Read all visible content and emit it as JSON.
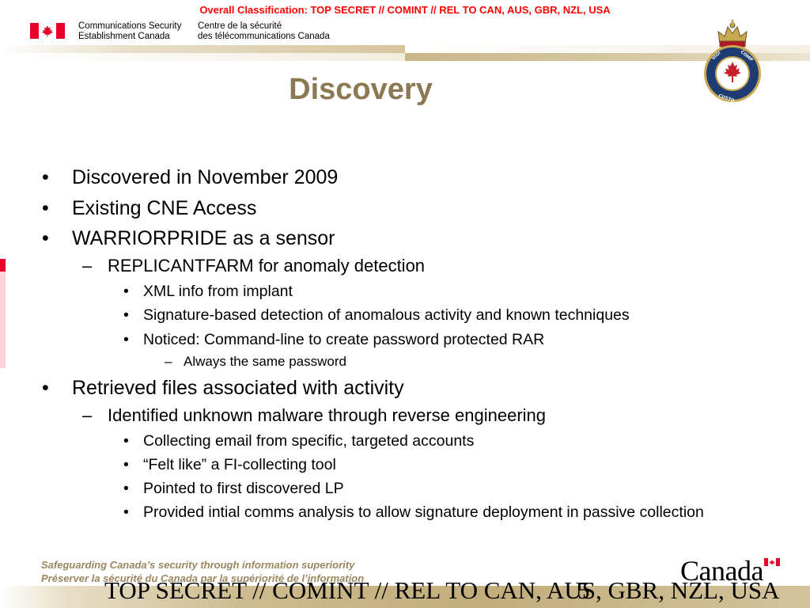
{
  "header": {
    "classification": "Overall Classification: TOP SECRET // COMINT // REL TO CAN, AUS, GBR, NZL, USA",
    "org_en_line1": "Communications Security",
    "org_en_line2": "Establishment Canada",
    "org_fr_line1": "Centre de la sécurité",
    "org_fr_line2": "des télécommunications Canada",
    "crest_motto": "VIGILANTIA NOSTRUM COMPANIE",
    "flag_icon": "canada-flag-icon"
  },
  "title": "Discovery",
  "bullets": [
    {
      "level": 1,
      "marker": "•",
      "text": "Discovered in November 2009"
    },
    {
      "level": 1,
      "marker": "•",
      "text": "Existing CNE Access"
    },
    {
      "level": 1,
      "marker": "•",
      "text": "WARRIORPRIDE as a sensor"
    },
    {
      "level": 2,
      "marker": "–",
      "text": "REPLICANTFARM for anomaly detection"
    },
    {
      "level": 3,
      "marker": "•",
      "text": "XML info from implant"
    },
    {
      "level": 3,
      "marker": "•",
      "text": "Signature-based detection of anomalous activity and known techniques"
    },
    {
      "level": 3,
      "marker": "•",
      "text": "Noticed: Command-line to create password protected RAR"
    },
    {
      "level": 4,
      "marker": "–",
      "text": "Always the same password"
    },
    {
      "level": 1,
      "marker": "•",
      "text": "Retrieved files associated with activity"
    },
    {
      "level": 2,
      "marker": "–",
      "text": "Identified unknown malware through reverse engineering"
    },
    {
      "level": 3,
      "marker": "•",
      "text": "Collecting email from specific, targeted accounts"
    },
    {
      "level": 3,
      "marker": "•",
      "text": "“Felt like” a FI-collecting tool"
    },
    {
      "level": 3,
      "marker": "•",
      "text": "Pointed to first discovered LP"
    },
    {
      "level": 3,
      "marker": "•",
      "text": "Provided intial comms analysis to allow signature deployment in passive collection"
    }
  ],
  "footer": {
    "tagline_en": "Safeguarding Canada’s security through information superiority",
    "tagline_fr": "Préserver la sécurité du Canada par la supériorité de l’information",
    "wordmark": "Canada",
    "classification": "TOP SECRET // COMINT // REL TO CAN, AUS, GBR, NZL, USA",
    "page_number": "5"
  },
  "colors": {
    "classification_red": "#ff0000",
    "title_gold": "#8c7853",
    "tagline_gold": "#9b8660",
    "band_gold": "#c2ad7b",
    "flag_red": "#e8002a"
  }
}
